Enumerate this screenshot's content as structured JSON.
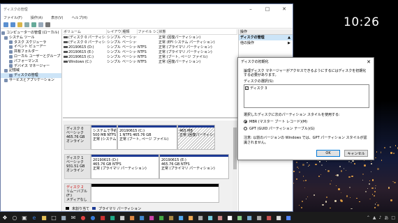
{
  "desktop": {
    "clock": "10:26"
  },
  "window": {
    "title": "ディスクの管理",
    "menu": [
      "ファイル(F)",
      "操作(A)",
      "表示(V)",
      "ヘルプ(H)"
    ]
  },
  "tree": [
    "コンピューターの管理 (ローカル)",
    "システム ツール",
    "タスク スケジューラ",
    "イベント ビューアー",
    "共有フォルダー",
    "ローカル ユーザーとグループ",
    "パフォーマンス",
    "デバイス マネージャー",
    "記憶域",
    "ディスクの管理",
    "サービスとアプリケーション"
  ],
  "volume_table": {
    "headers": [
      "ボリューム",
      "レイアウト",
      "種類",
      "ファイル システム",
      "状態"
    ],
    "rows": [
      [
        "(ディスク 0 パーティション 1)",
        "シンプル",
        "ベーシック",
        "",
        "正常 (回復パーティション)"
      ],
      [
        "(ディスク 0 パーティション 2)",
        "シンプル",
        "ベーシック",
        "",
        "正常 (EFI システム パーティション)"
      ],
      [
        "20190615 (D:)",
        "シンプル",
        "ベーシック",
        "NTFS",
        "正常 (プライマリ パーティション)"
      ],
      [
        "20190615 (E:)",
        "シンプル",
        "ベーシック",
        "NTFS",
        "正常 (プライマリ パーティション)"
      ],
      [
        "20190615 (C:)",
        "シンプル",
        "ベーシック",
        "NTFS",
        "正常 (ブート, ページ ファイル)"
      ],
      [
        "Windows (C:)",
        "シンプル",
        "ベーシック",
        "NTFS",
        "正常 (回復パーティション)"
      ]
    ]
  },
  "disks": [
    {
      "label": [
        "ディスク 0",
        "ベーシック",
        "465.76 GB",
        "オンライン"
      ],
      "parts": [
        {
          "lines": [
            "システムで予約",
            "500 MB NTFS",
            "正常 (システム)"
          ],
          "hatch": false
        },
        {
          "lines": [
            "20190615 (C:)",
            "1 NTFS 465.76 GB",
            "正常 (ブート, ページ ファイル)"
          ],
          "hatch": false
        },
        {
          "lines": [
            "",
            "465 MB",
            "正常 (回復パーティション)"
          ],
          "hatch": true
        }
      ]
    },
    {
      "label": [
        "ディスク 1",
        "ベーシック",
        "931.51 GB",
        "オンライン"
      ],
      "parts": [
        {
          "lines": [
            "20190615 (D:)",
            "465.76 GB NTFS",
            "正常 (プライマリ パーティション)"
          ],
          "hatch": false
        },
        {
          "lines": [
            "20190615 (E:)",
            "465.76 GB NTFS",
            "正常 (プライマリ パーティション)"
          ],
          "hatch": false
        }
      ]
    },
    {
      "label": [
        "ディスク 2",
        "リムーバブル (F:)",
        "",
        "メディアなし"
      ],
      "parts": [
        {
          "lines": [
            "",
            "",
            ""
          ],
          "hatch": false
        }
      ]
    }
  ],
  "legend": [
    "未割り当て",
    "プライマリ パーティション"
  ],
  "actions": {
    "header": "操作",
    "items": [
      {
        "label": "ディスクの管理",
        "highlight": true
      },
      {
        "label": "他の操作",
        "highlight": false
      }
    ]
  },
  "dialog": {
    "title": "ディスクの初期化",
    "description": "論理ディスク マネージャーがアクセスできるようにするにはディスクを初期化する必要があります。",
    "disk_label": "ディスクの選択(S):",
    "disk_option": "ディスク 3",
    "style_label": "選択したディスクに次のパーティション スタイルを使用する:",
    "radio1": "MBR (マスター ブート レコード)(M)",
    "radio2": "GPT (GUID パーティション テーブル)(G)",
    "note": "注意: 以前のバージョンの Windows では、GPT パーティション スタイルが認識されません。",
    "ok": "OK",
    "cancel": "キャンセル"
  }
}
